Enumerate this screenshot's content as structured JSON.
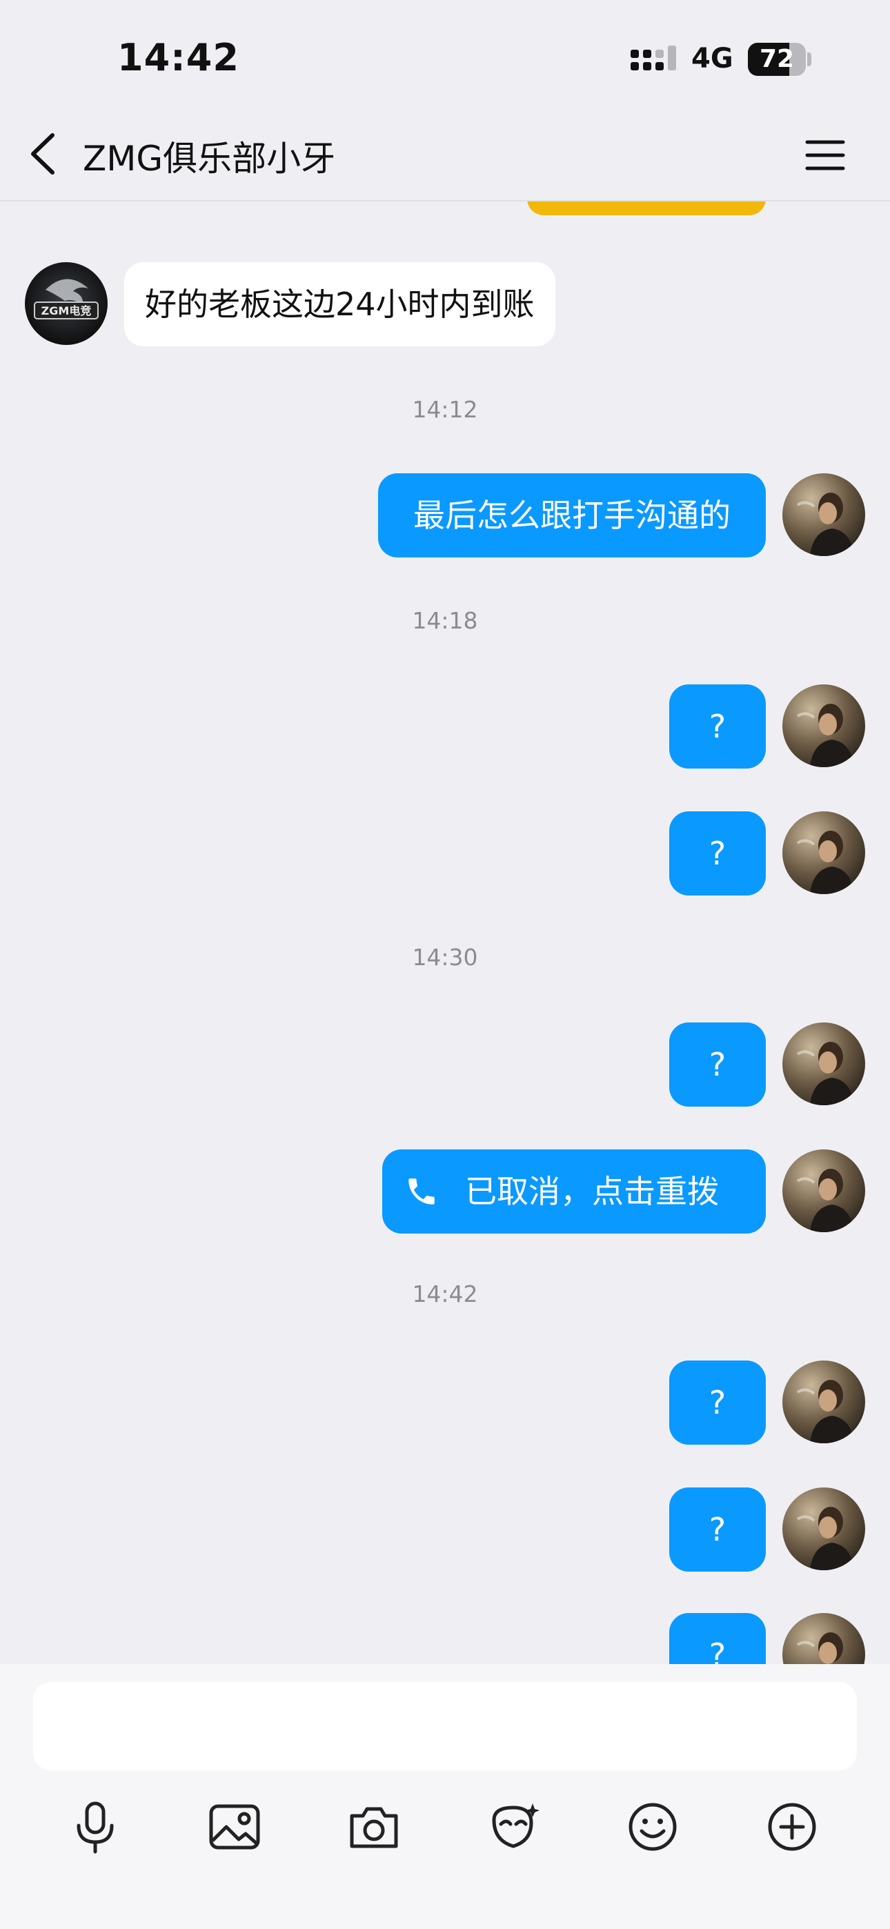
{
  "status_bar": {
    "time": "14:42",
    "network": "4G",
    "battery": "72",
    "battery_level": 0.72
  },
  "header": {
    "title": "ZMG俱乐部小牙"
  },
  "messages": {
    "incoming_1": "好的老板这边24小时内到账",
    "ts_1": "14:12",
    "out_1": "最后怎么跟打手沟通的",
    "ts_2": "14:18",
    "out_2": "?",
    "out_3": "?",
    "ts_3": "14:30",
    "out_4": "?",
    "call": "已取消，点击重拨",
    "ts_4": "14:42",
    "out_5": "?",
    "out_6": "?",
    "out_7": "?"
  },
  "avatars": {
    "contact_logo_text": "ZGM电竞"
  },
  "toolbar": {
    "icons": [
      "microphone-icon",
      "image-icon",
      "camera-icon",
      "sticker-icon",
      "emoji-icon",
      "plus-icon"
    ]
  },
  "colors": {
    "outgoing_bubble": "#0a99ff",
    "incoming_bubble": "#ffffff",
    "background": "#efeff3",
    "accent_yellow": "#f1b80a"
  }
}
